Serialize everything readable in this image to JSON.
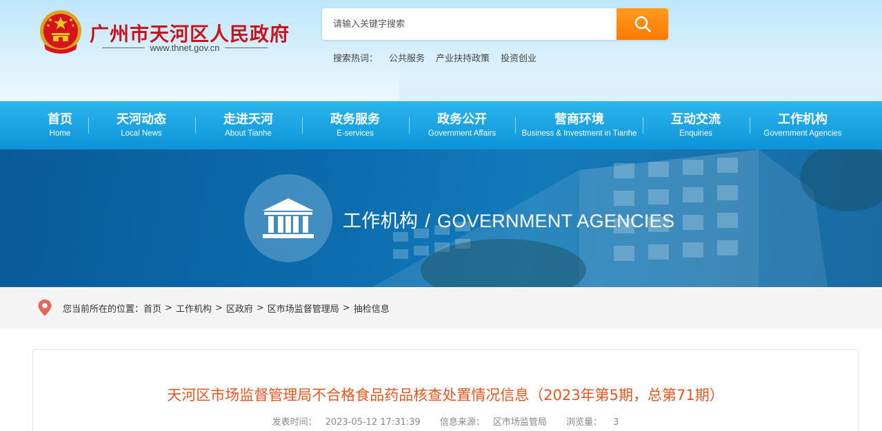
{
  "header": {
    "site_title": "广州市天河区人民政府",
    "site_url": "www.thnet.gov.cn",
    "search_placeholder": "请输入关键字搜索",
    "hot_label": "搜索热词：",
    "hot_words": [
      "公共服务",
      "产业扶持政策",
      "投资创业"
    ]
  },
  "nav": [
    {
      "cn": "首页",
      "en": "Home"
    },
    {
      "cn": "天河动态",
      "en": "Local News"
    },
    {
      "cn": "走进天河",
      "en": "About Tianhe"
    },
    {
      "cn": "政务服务",
      "en": "E-services"
    },
    {
      "cn": "政务公开",
      "en": "Government Affairs"
    },
    {
      "cn": "营商环境",
      "en": "Business & Investment in Tianhe"
    },
    {
      "cn": "互动交流",
      "en": "Enquiries"
    },
    {
      "cn": "工作机构",
      "en": "Government Agencies"
    }
  ],
  "banner": {
    "title_cn": "工作机构",
    "slash": "/",
    "title_en": "GOVERNMENT AGENCIES"
  },
  "breadcrumb": {
    "label": "您当前所在的位置：",
    "items": [
      "首页",
      "工作机构",
      "区政府",
      "区市场监督管理局",
      "抽检信息"
    ],
    "separator": ">"
  },
  "article": {
    "title": "天河区市场监督管理局不合格食品药品核查处置情况信息（2023年第5期，总第71期）",
    "publish_label": "发表时间：",
    "publish_time": "2023-05-12 17:31:39",
    "source_label": "信息来源：",
    "source": "区市场监管局",
    "views_label": "浏览量：",
    "views": "3"
  },
  "colors": {
    "brand_red": "#c9141b",
    "nav_blue": "#0d93d8",
    "search_orange": "#ff7a00",
    "title_orange": "#e8541c"
  }
}
